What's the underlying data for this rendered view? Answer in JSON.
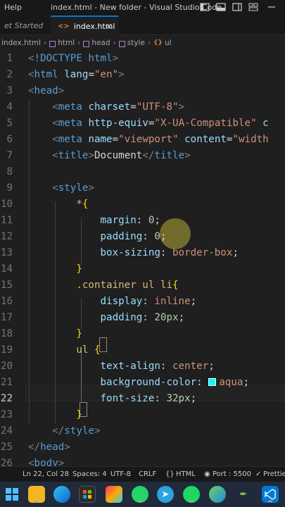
{
  "titlebar": {
    "menu_help": "Help",
    "title": "index.html - New folder - Visual Studio Code"
  },
  "tabs": {
    "get_started": "et Started",
    "active_file": "index.html",
    "close_glyph": "×"
  },
  "breadcrumb": {
    "file": "index.html",
    "items": [
      "html",
      "head",
      "style",
      "ul"
    ]
  },
  "editor": {
    "active_line": 22,
    "colors": {
      "aqua_swatch": "#00ffff"
    },
    "lines": [
      {
        "n": "1"
      },
      {
        "n": "2"
      },
      {
        "n": "3"
      },
      {
        "n": "4"
      },
      {
        "n": "5"
      },
      {
        "n": "6"
      },
      {
        "n": "7"
      },
      {
        "n": "8"
      },
      {
        "n": "9"
      },
      {
        "n": "10"
      },
      {
        "n": "11"
      },
      {
        "n": "12"
      },
      {
        "n": "13"
      },
      {
        "n": "14"
      },
      {
        "n": "15"
      },
      {
        "n": "16"
      },
      {
        "n": "17"
      },
      {
        "n": "18"
      },
      {
        "n": "19"
      },
      {
        "n": "20"
      },
      {
        "n": "21"
      },
      {
        "n": "22"
      },
      {
        "n": "23"
      },
      {
        "n": "24"
      },
      {
        "n": "25"
      },
      {
        "n": "26"
      }
    ],
    "tokens": {
      "l1_doctype": "!DOCTYPE html",
      "l2_tag": "html",
      "l2_attr": "lang",
      "l2_val": "\"en\"",
      "l3_tag": "head",
      "l4_tag": "meta",
      "l4_attr": "charset",
      "l4_val": "\"UTF-8\"",
      "l5_tag": "meta",
      "l5_attr": "http-equiv",
      "l5_val": "\"X-UA-Compatible\"",
      "l5_rest": "c",
      "l6_tag": "meta",
      "l6_attr": "name",
      "l6_val": "\"viewport\"",
      "l6_attr2": "content",
      "l6_val2": "\"width",
      "l7_tag": "title",
      "l7_text": "Document",
      "l7_tag_close": "title",
      "l9_tag": "style",
      "l10_sel": "*",
      "l11_prop": "margin",
      "l11_val": "0",
      "l12_prop": "padding",
      "l12_val": "0",
      "l13_prop": "box-sizing",
      "l13_val": "border-box",
      "l15_sel": ".container ul li",
      "l16_prop": "display",
      "l16_val": "inline",
      "l17_prop": "padding",
      "l17_val": "20px",
      "l19_sel": "ul",
      "l20_prop": "text-align",
      "l20_val": "center",
      "l21_prop": "background-color",
      "l21_val": "aqua",
      "l22_prop": "font-size",
      "l22_val": "32px",
      "l24_tag": "style",
      "l25_tag": "head",
      "l26_tag": "body"
    }
  },
  "statusbar": {
    "position": "Ln 22, Col 28",
    "spaces": "Spaces: 4",
    "encoding": "UTF-8",
    "eol": "CRLF",
    "language": "HTML",
    "port": "Port : 5500",
    "prettier": "Prettie"
  },
  "taskbar": {
    "icons": [
      "windows-start-icon",
      "file-explorer-icon",
      "edge-icon",
      "store-icon",
      "photos-icon",
      "whatsapp-icon",
      "telegram-icon",
      "spotify-icon",
      "edge-canary-icon",
      "pen-icon",
      "vscode-icon"
    ]
  }
}
